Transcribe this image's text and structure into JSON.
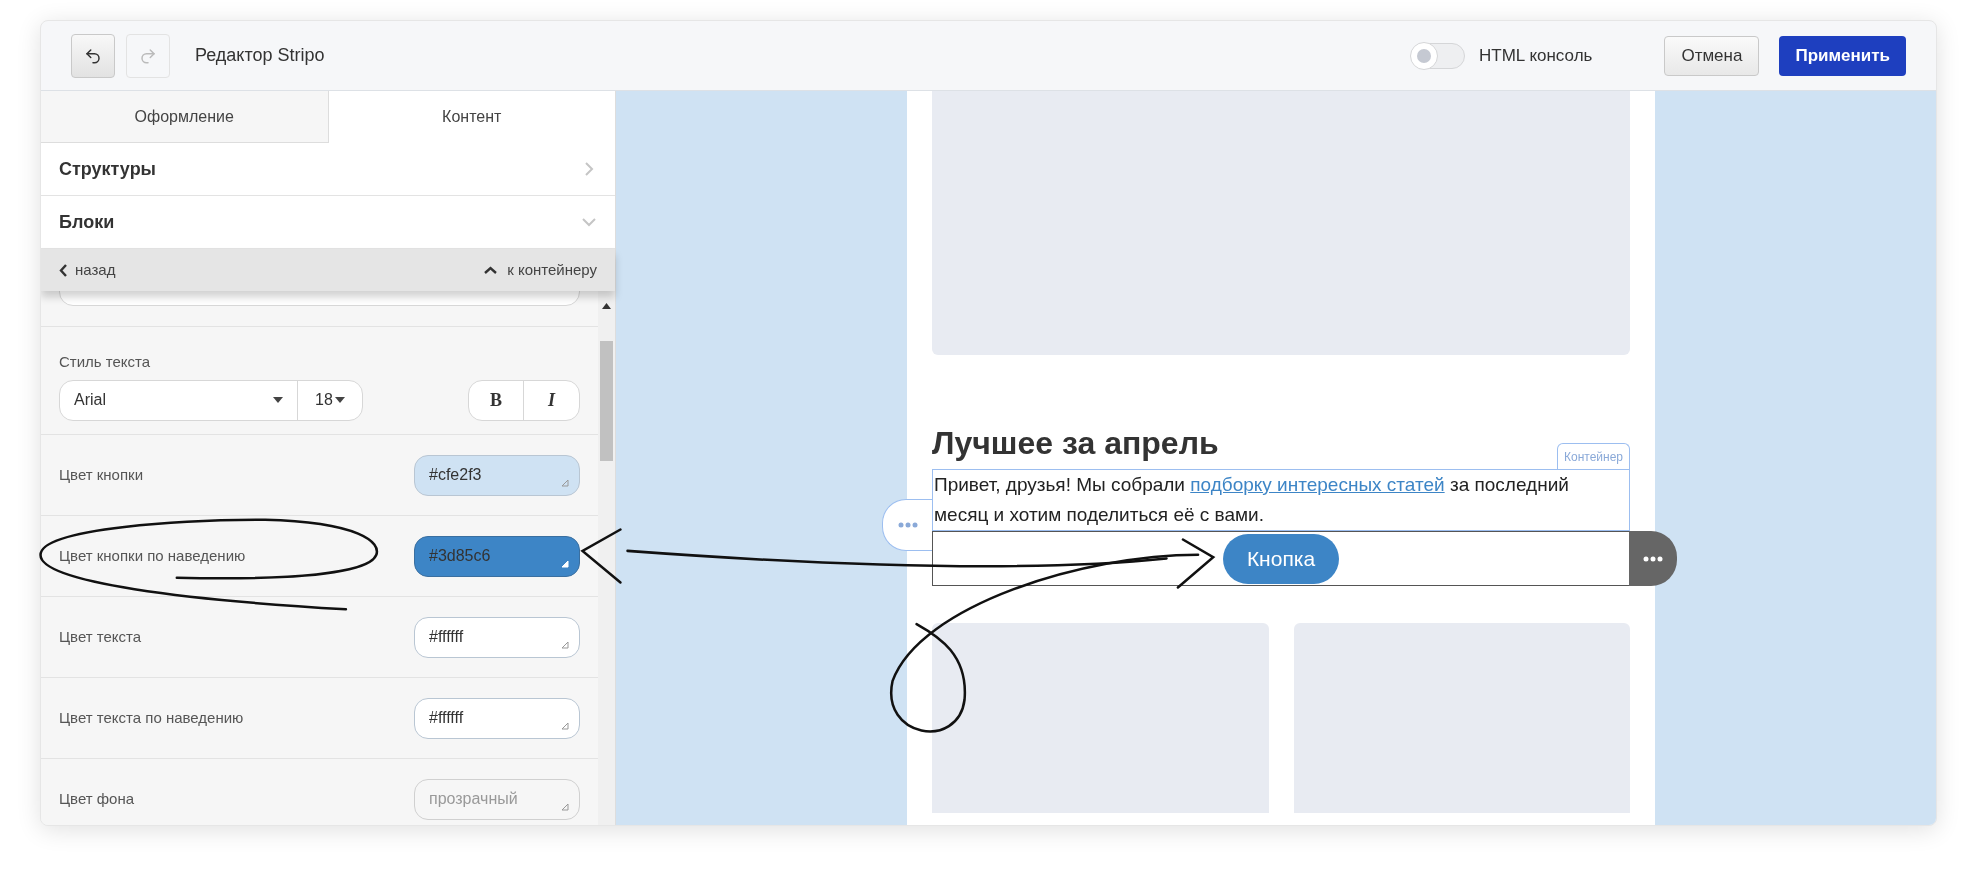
{
  "header": {
    "undo": {
      "disabled": false
    },
    "redo": {
      "disabled": true
    },
    "title": "Редактор Stripo",
    "html_console": {
      "label": "HTML консоль",
      "on": false
    },
    "cancel": "Отмена",
    "apply": "Применить"
  },
  "tabs": [
    {
      "label": "Оформление",
      "selected": false
    },
    {
      "label": "Контент",
      "selected": true
    }
  ],
  "sections": [
    {
      "label": "Структуры",
      "expanded": false
    },
    {
      "label": "Блоки",
      "expanded": true
    }
  ],
  "nav_bar": {
    "back": "назад",
    "up": "к контейнеру"
  },
  "text_style": {
    "label": "Стиль текста",
    "font": "Arial",
    "size": "18",
    "bold": "B",
    "italic": "I"
  },
  "color_rows": [
    {
      "label": "Цвет кнопки",
      "value": "#cfe2f3",
      "color": "#cfe2f3"
    },
    {
      "label": "Цвет кнопки по наведению",
      "value": "#3d85c6",
      "color": "#3d85c6"
    },
    {
      "label": "Цвет текста",
      "value": "#ffffff",
      "color": "#ffffff"
    },
    {
      "label": "Цвет текста по наведению",
      "value": "#ffffff",
      "color": "#ffffff"
    },
    {
      "label": "Цвет фона",
      "placeholder": "прозрачный"
    }
  ],
  "email": {
    "heading": "Лучшее за апрель",
    "container_label": "Контейнер",
    "text_before": "Привет, друзья! Мы собрали",
    "link": "подборку интересных статей",
    "text_after": "за последний месяц и хотим поделиться её с вами.",
    "button": "Кнопка"
  }
}
